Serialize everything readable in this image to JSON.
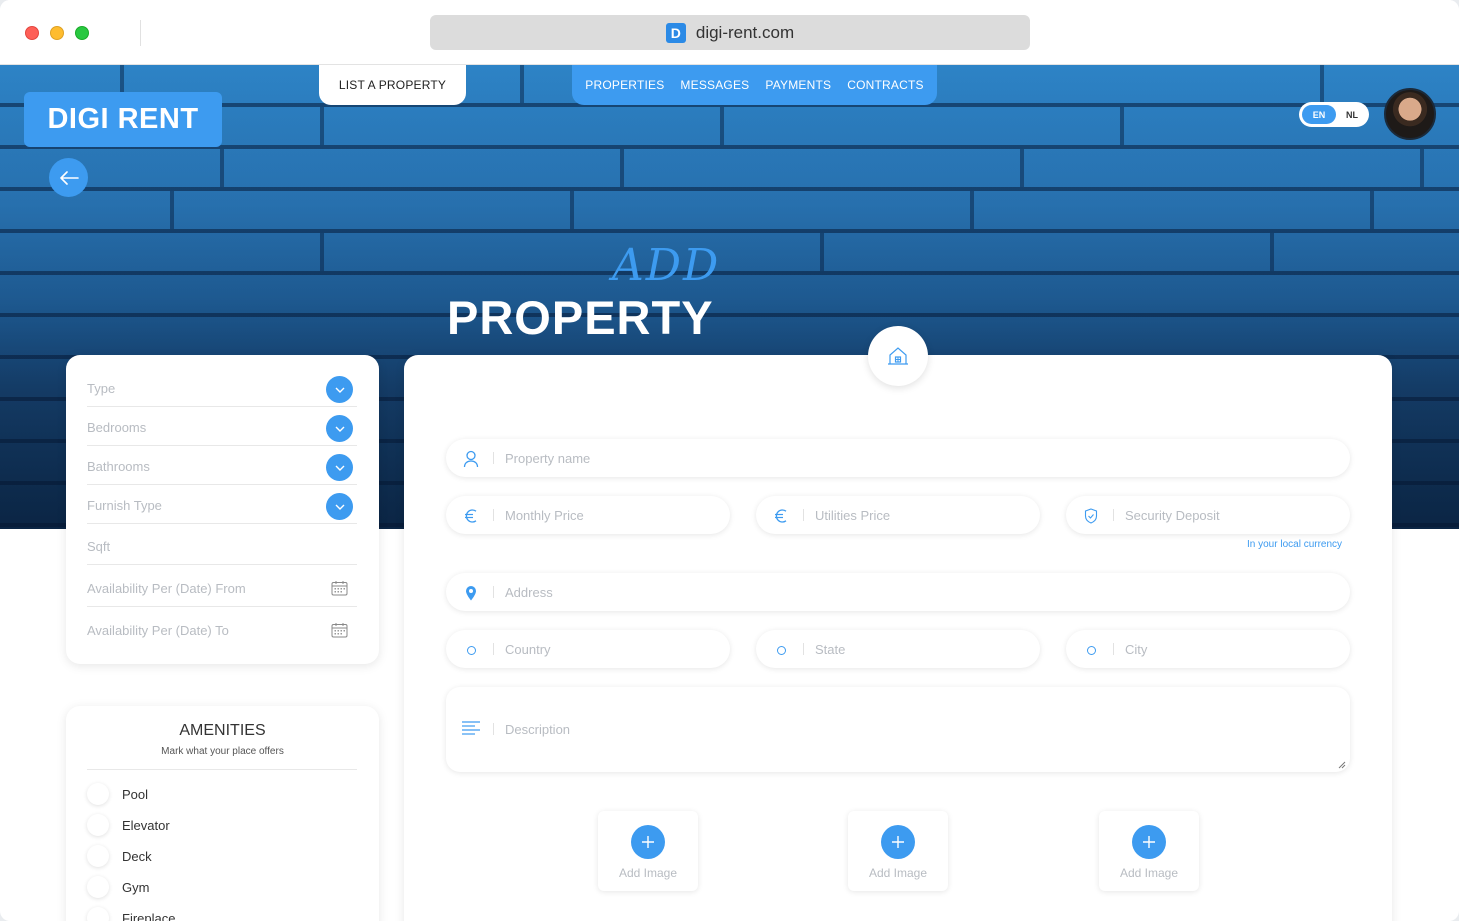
{
  "browser": {
    "url": "digi-rent.com",
    "favicon_letter": "D"
  },
  "nav": {
    "list_property": "LIST A PROPERTY",
    "items": [
      "PROPERTIES",
      "MESSAGES",
      "PAYMENTS",
      "CONTRACTS"
    ]
  },
  "brand": {
    "logo_text": "DIGI RENT",
    "accent_color": "#3d9bf0"
  },
  "lang": {
    "active": "EN",
    "other": "NL"
  },
  "hero": {
    "title_script": "ADD",
    "title_main": "PROPERTY"
  },
  "filters": {
    "type": "Type",
    "bedrooms": "Bedrooms",
    "bathrooms": "Bathrooms",
    "furnish": "Furnish Type",
    "sqft": "Sqft",
    "avail_from": "Availability Per (Date) From",
    "avail_to": "Availability Per (Date) To"
  },
  "amenities": {
    "title": "AMENITIES",
    "subtitle": "Mark what your place offers",
    "items": [
      "Pool",
      "Elevator",
      "Deck",
      "Gym",
      "Fireplace"
    ]
  },
  "form": {
    "property_name": "Property name",
    "monthly_price": "Monthly Price",
    "utilities_price": "Utilities Price",
    "security_deposit": "Security Deposit",
    "currency_hint": "In your local currency",
    "address": "Address",
    "country": "Country",
    "state": "State",
    "city": "City",
    "description": "Description",
    "add_image": "Add Image"
  }
}
